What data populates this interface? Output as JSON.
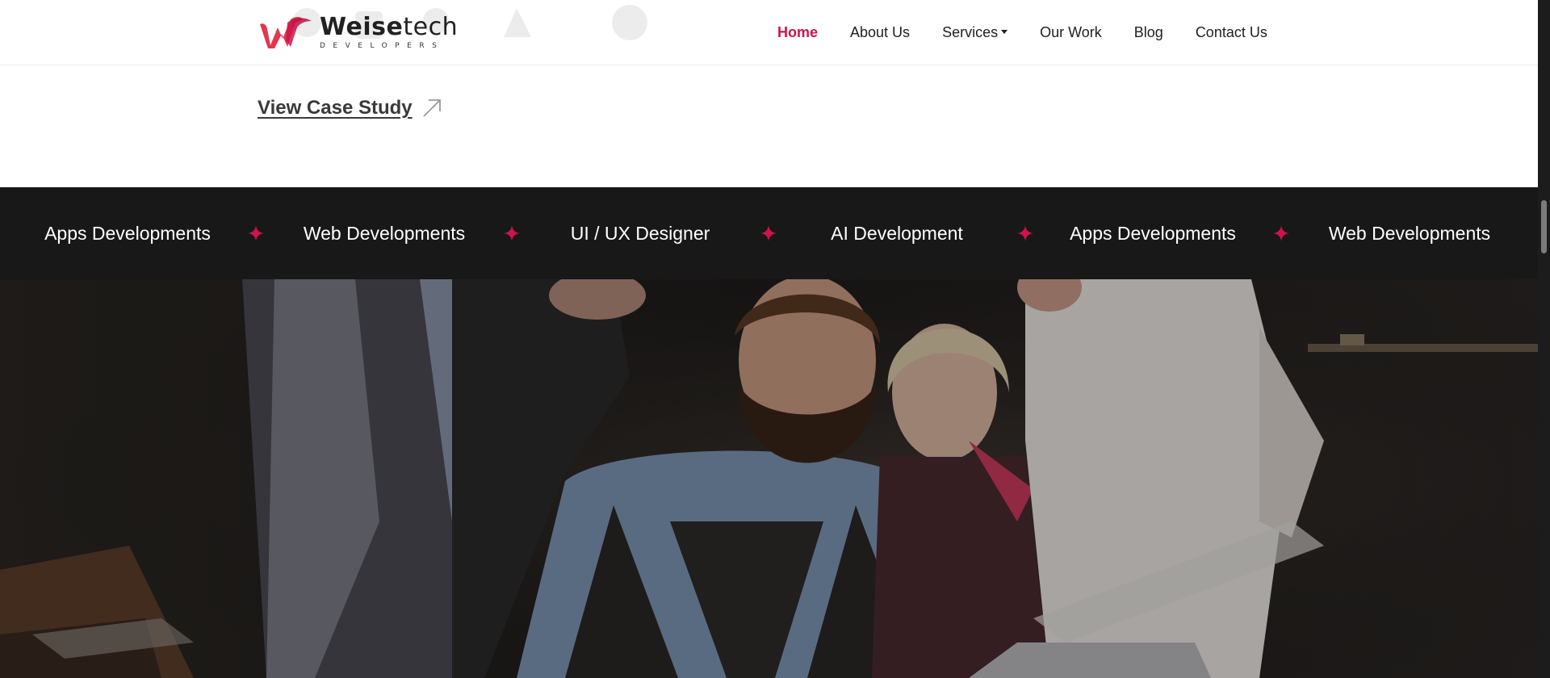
{
  "header": {
    "logo": {
      "name_bold": "Weise",
      "name_light": "tech",
      "sub": "DEVELOPERS"
    },
    "nav": [
      {
        "label": "Home"
      },
      {
        "label": "About Us"
      },
      {
        "label": "Services"
      },
      {
        "label": "Our Work"
      },
      {
        "label": "Blog"
      },
      {
        "label": "Contact Us"
      }
    ]
  },
  "case_study": {
    "label": "View Case Study "
  },
  "ticker": {
    "items": [
      "Apps Developments",
      "Web Developments",
      "UI / UX Designer",
      "AI Development",
      "Apps Developments",
      "Web Developments"
    ]
  },
  "icons": {
    "star": "sparkle-star-icon",
    "arrow": "arrow-up-right-icon",
    "caret": "chevron-down-icon"
  },
  "colors": {
    "accent": "#d0134a",
    "ticker_bg": "#181818",
    "text_dark": "#1f1f1f"
  }
}
